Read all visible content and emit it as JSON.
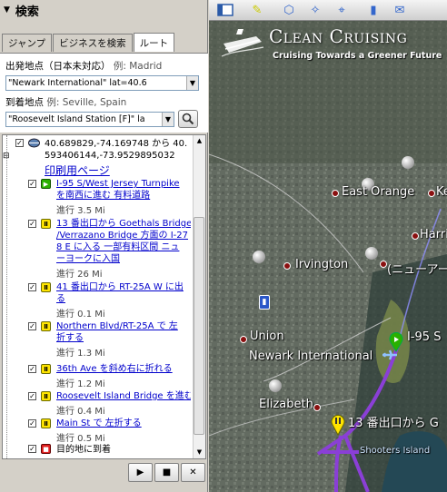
{
  "panel": {
    "title": "検索",
    "tabs": [
      "ジャンプ",
      "ビジネスを検索",
      "ルート"
    ],
    "from_label": "出発地点（日本未対応）",
    "from_example": "例: Madrid",
    "from_value": "\"Newark International\" lat=40.6",
    "to_label": "到着地点",
    "to_example": "例: Seville, Spain",
    "to_value": "\"Roosevelt Island Station [F]\" la"
  },
  "route": {
    "header_line1": "40.689829,-74.169748 から 40.",
    "header_line2": "593406144,-73.9529895032",
    "print_link": "印刷用ページ",
    "steps": [
      {
        "text": "I-95 S/West Jersey Turnpike\nを南西に進む 有料道路",
        "dist": "進行 3.5 Mi",
        "icon": "green"
      },
      {
        "text": "13 番出口から Goethals Bridge\n/Verrazano Bridge 方面の I-27\n8 E に入る 一部有料区間 ニュ\nーヨークに入国",
        "dist": "進行 26 Mi",
        "icon": "yellow"
      },
      {
        "text": "41 番出口から RT-25A W に出\nる",
        "dist": "進行 0.1 Mi",
        "icon": "yellow"
      },
      {
        "text": "Northern Blvd/RT-25A で 左\n折する",
        "dist": "進行 1.3 Mi",
        "icon": "yellow"
      },
      {
        "text": "36th Ave を斜め右に折れる",
        "dist": "進行 1.2 Mi",
        "icon": "yellow"
      },
      {
        "text": "Roosevelt Island Bridge を進む",
        "dist": "進行 0.4 Mi",
        "icon": "yellow"
      },
      {
        "text": "Main St で 左折する",
        "dist": "進行 0.5 Mi",
        "icon": "yellow"
      }
    ],
    "arrival": "目的地に到着"
  },
  "controls": {
    "play": "▶",
    "stop": "■",
    "close": "✕"
  },
  "map": {
    "logo_title": "Clean Cruising",
    "logo_tagline": "Cruising Towards a Greener Future",
    "labels": {
      "east_orange": "East Orange",
      "ke": "Ke",
      "harris": "Harris",
      "irvington": "Irvington",
      "newark_jp": "(ニューアー",
      "union": "Union",
      "newark_intl": "Newark International",
      "i95": "I-95 S",
      "elizabeth": "Elizabeth",
      "exit13": "13 番出口から G",
      "shooters": "Shooters Island"
    }
  }
}
